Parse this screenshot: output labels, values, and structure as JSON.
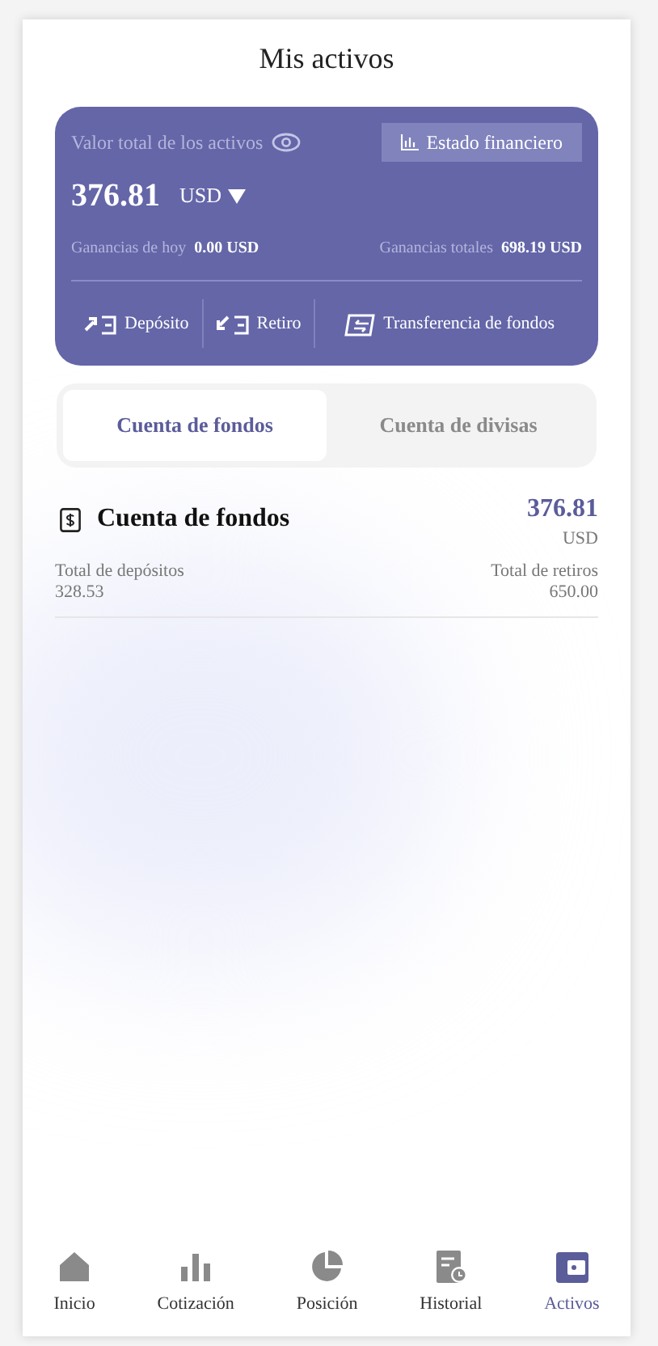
{
  "header": {
    "title": "Mis activos"
  },
  "summary": {
    "label": "Valor total de los activos",
    "statement_button": "Estado financiero",
    "total": "376.81",
    "currency": "USD",
    "today_label": "Ganancias de hoy",
    "today_value": "0.00 USD",
    "total_label": "Ganancias totales",
    "total_value": "698.19 USD",
    "actions": [
      {
        "label": "Depósito"
      },
      {
        "label": "Retiro"
      },
      {
        "label": "Transferencia de fondos"
      }
    ]
  },
  "tabs": [
    {
      "label": "Cuenta de fondos",
      "selected": true
    },
    {
      "label": "Cuenta de divisas",
      "selected": false
    }
  ],
  "account": {
    "name": "Cuenta de fondos",
    "amount": "376.81",
    "currency": "USD",
    "deposits_label": "Total de depósitos",
    "deposits_value": "328.53",
    "withdrawals_label": "Total de retiros",
    "withdrawals_value": "650.00"
  },
  "nav": [
    {
      "label": "Inicio",
      "selected": false
    },
    {
      "label": "Cotización",
      "selected": false
    },
    {
      "label": "Posición",
      "selected": false
    },
    {
      "label": "Historial",
      "selected": false
    },
    {
      "label": "Activos",
      "selected": true
    }
  ]
}
